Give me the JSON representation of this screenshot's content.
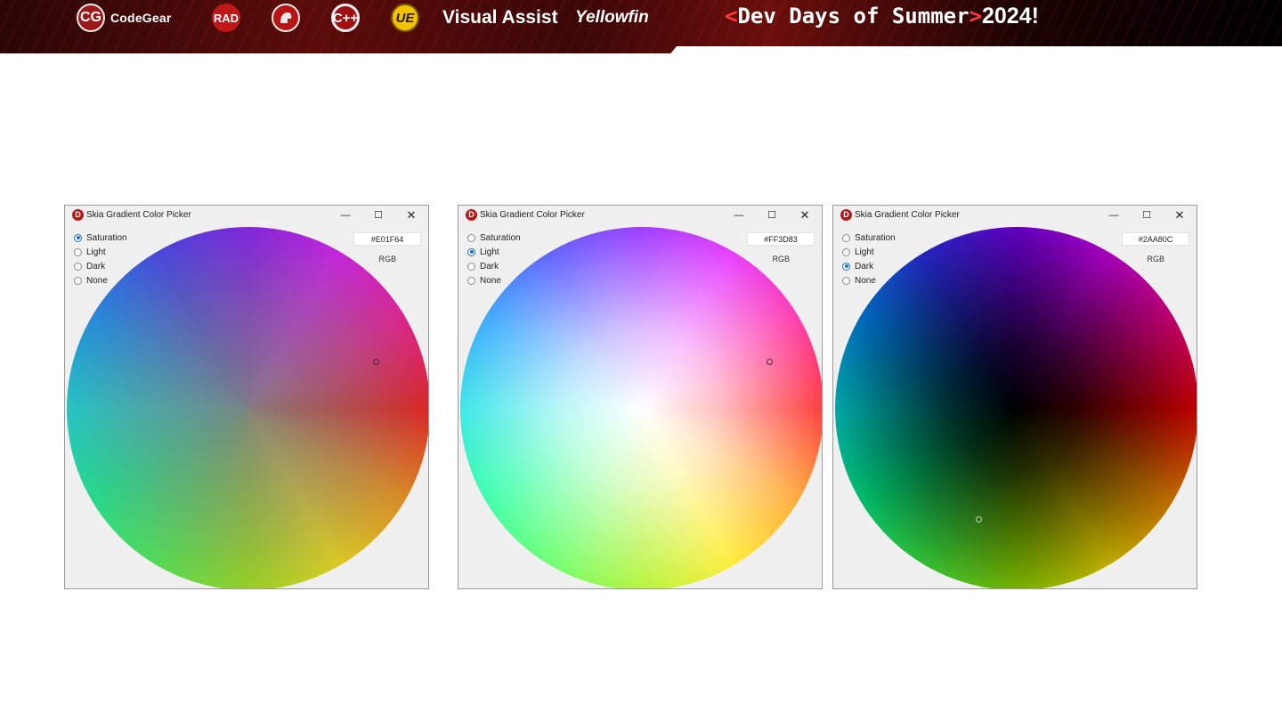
{
  "banner": {
    "codegear_badge": "CG",
    "codegear_label": "CodeGear",
    "rad_badge": "RAD",
    "cpp_badge": "C++",
    "ue_badge": "UE",
    "visual_assist_label": "Visual Assist",
    "yellowfin_label": "Yellowfin",
    "dev_days_prefix": "<",
    "dev_days_text": "Dev Days of Summer",
    "dev_days_suffix": ">",
    "dev_days_year": "2024!"
  },
  "windows": [
    {
      "title": "Skia Gradient Color Picker",
      "options": [
        "Saturation",
        "Light",
        "Dark",
        "None"
      ],
      "selected_option": "Saturation",
      "hex_value": "#E01F64",
      "rgb_label": "RGB"
    },
    {
      "title": "Skia Gradient Color Picker",
      "options": [
        "Saturation",
        "Light",
        "Dark",
        "None"
      ],
      "selected_option": "Light",
      "hex_value": "#FF3D83",
      "rgb_label": "RGB"
    },
    {
      "title": "Skia Gradient Color Picker",
      "options": [
        "Saturation",
        "Light",
        "Dark",
        "None"
      ],
      "selected_option": "Dark",
      "hex_value": "#2AA80C",
      "rgb_label": "RGB"
    }
  ],
  "icons": {
    "app_icon": "D",
    "minimize": "—",
    "maximize": "☐",
    "close": "✕"
  },
  "colors": {
    "accent_radio": "#1a6fc9",
    "banner_dark": "#2a0606",
    "app_icon_red": "#b31b1b"
  }
}
